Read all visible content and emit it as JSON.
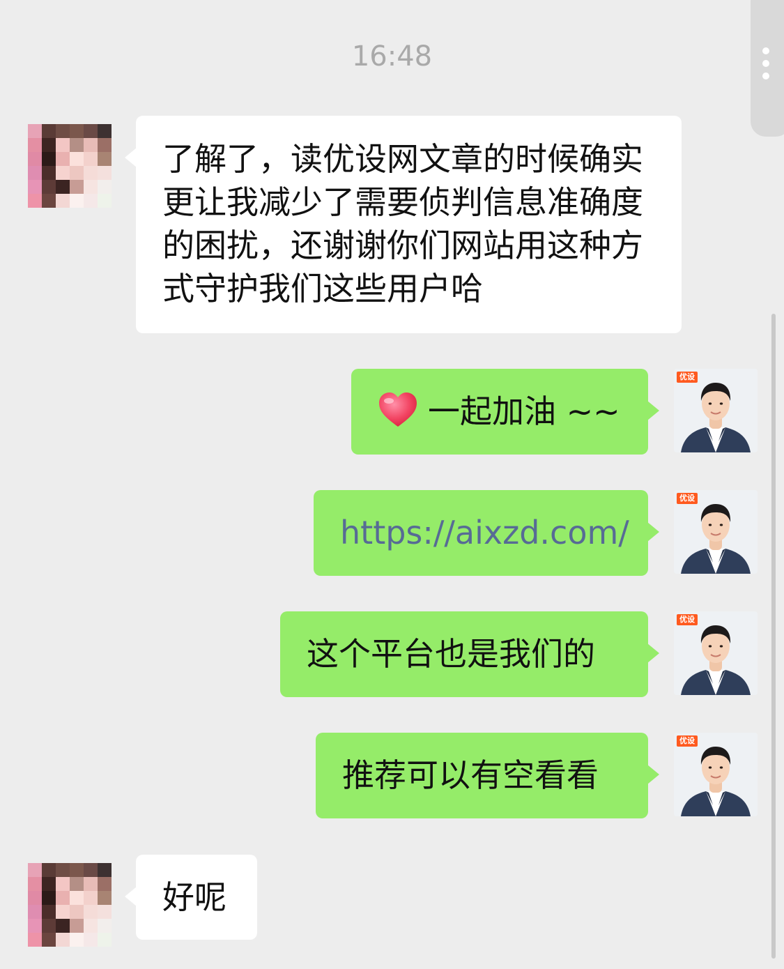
{
  "chat": {
    "timestamp": "16:48",
    "messages": [
      {
        "side": "left",
        "text": "了解了，读优设网文章的时候确实更让我减少了需要侦判信息准确度的困扰，还谢谢你们网站用这种方式守护我们这些用户哈"
      },
      {
        "side": "right",
        "icon": "heart-icon",
        "text": "一起加油 ~~"
      },
      {
        "side": "right",
        "type": "link",
        "text": "https://aixzd.com/"
      },
      {
        "side": "right",
        "text": "这个平台也是我们的"
      },
      {
        "side": "right",
        "text": "推荐可以有空看看"
      },
      {
        "side": "left",
        "text": "好呢"
      }
    ],
    "own_avatar_badge": "优设"
  },
  "colors": {
    "background": "#ededed",
    "bubble_self": "#95ec69",
    "bubble_other": "#ffffff",
    "link": "#576b95",
    "timestamp": "#a9a9a9"
  }
}
